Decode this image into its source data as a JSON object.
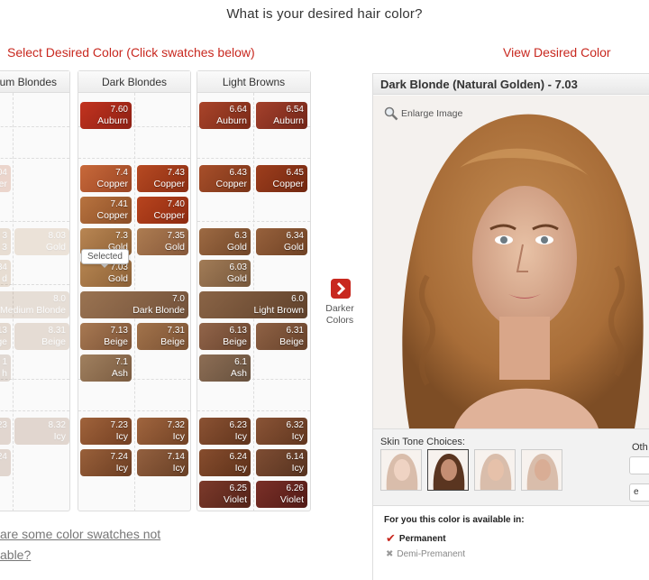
{
  "question": "What is your desired hair color?",
  "left_title": "Select Desired Color (Click swatches below)",
  "right_title": "View Desired Color",
  "columns": [
    {
      "label": "um Blondes"
    },
    {
      "label": "Dark Blondes"
    },
    {
      "label": "Light Browns"
    }
  ],
  "swatches": {
    "medium": [
      {
        "code": "04",
        "name": "er"
      },
      {
        "code": "3",
        "name": "3"
      },
      {
        "code": "8.03",
        "name": "Gold"
      },
      {
        "code": "34",
        "name": "d"
      },
      {
        "code": "8.0",
        "name": "Medium Blonde"
      },
      {
        "code": "13",
        "name": "ge"
      },
      {
        "code": "8.31",
        "name": "Beige"
      },
      {
        "code": "1",
        "name": "h"
      },
      {
        "code": "23",
        "name": ""
      },
      {
        "code": "8.32",
        "name": "Icy"
      },
      {
        "code": "24",
        "name": ""
      }
    ],
    "dark": [
      {
        "code": "7.60",
        "name": "Auburn"
      },
      {
        "code": "7.4",
        "name": "Copper"
      },
      {
        "code": "7.43",
        "name": "Copper"
      },
      {
        "code": "7.41",
        "name": "Copper"
      },
      {
        "code": "7.40",
        "name": "Copper"
      },
      {
        "code": "7.3",
        "name": "Gold"
      },
      {
        "code": "7.35",
        "name": "Gold"
      },
      {
        "code": "7.03",
        "name": "Gold"
      },
      {
        "code": "7.0",
        "name": "Dark Blonde"
      },
      {
        "code": "7.13",
        "name": "Beige"
      },
      {
        "code": "7.31",
        "name": "Beige"
      },
      {
        "code": "7.1",
        "name": "Ash"
      },
      {
        "code": "7.23",
        "name": "Icy"
      },
      {
        "code": "7.32",
        "name": "Icy"
      },
      {
        "code": "7.24",
        "name": "Icy"
      },
      {
        "code": "7.14",
        "name": "Icy"
      }
    ],
    "light": [
      {
        "code": "6.64",
        "name": "Auburn"
      },
      {
        "code": "6.54",
        "name": "Auburn"
      },
      {
        "code": "6.43",
        "name": "Copper"
      },
      {
        "code": "6.45",
        "name": "Copper"
      },
      {
        "code": "6.3",
        "name": "Gold"
      },
      {
        "code": "6.34",
        "name": "Gold"
      },
      {
        "code": "6.03",
        "name": "Gold"
      },
      {
        "code": "6.0",
        "name": "Light Brown"
      },
      {
        "code": "6.13",
        "name": "Beige"
      },
      {
        "code": "6.31",
        "name": "Beige"
      },
      {
        "code": "6.1",
        "name": "Ash"
      },
      {
        "code": "6.23",
        "name": "Icy"
      },
      {
        "code": "6.32",
        "name": "Icy"
      },
      {
        "code": "6.24",
        "name": "Icy"
      },
      {
        "code": "6.14",
        "name": "Icy"
      },
      {
        "code": "6.25",
        "name": "Violet"
      },
      {
        "code": "6.26",
        "name": "Violet"
      }
    ]
  },
  "tooltip": "Selected",
  "darker_colors": {
    "line1": "Darker",
    "line2": "Colors"
  },
  "question_link": {
    "line1": "are some color swatches not",
    "line2": "able?"
  },
  "preview": {
    "title": "Dark Blonde (Natural Golden) - 7.03",
    "enlarge": "Enlarge Image",
    "skin_tone_label": "Skin Tone Choices:",
    "other_label": "Oth",
    "other_box2": "e"
  },
  "availability": {
    "title": "For you this color is available in:",
    "permanent": "Permanent",
    "demi": "Demi-Premanent"
  },
  "colors": {
    "accent": "#c8281f",
    "auburn": "#a8301d",
    "copper": "#b8552c",
    "gold": "#a87a4a",
    "beige": "#93663e",
    "ash": "#8b6a4c",
    "icy": "#8a5a3a",
    "violet": "#7a3a2a",
    "dark_blonde": "#8c6545",
    "light_brown": "#805b3d"
  }
}
